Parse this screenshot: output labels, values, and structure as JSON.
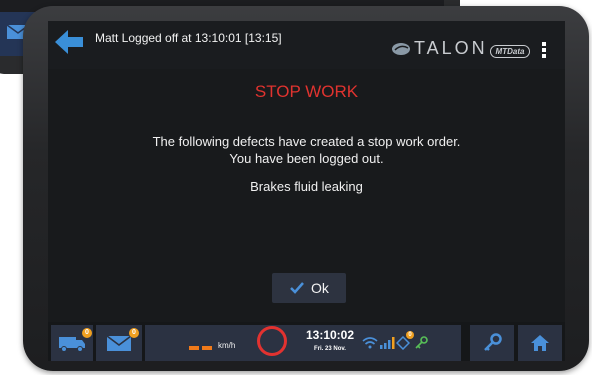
{
  "header": {
    "status_message": "Matt Logged off at 13:10:01 [13:15]",
    "brand": "TALON",
    "partner_logo": "MTData",
    "back_icon": "arrow-left-icon",
    "menu_icon": "kebab-menu-icon"
  },
  "dialog": {
    "title": "STOP WORK",
    "message_line1": "The following defects have created a stop work order.",
    "message_line2": "You have been logged out.",
    "defect": "Brakes fluid leaking",
    "ok_label": "Ok"
  },
  "bottom_bar": {
    "truck_badge": "0",
    "mail_badge": "0",
    "speed_unit": "km/h",
    "time": "13:10:02",
    "date": "Fri. 23 Nov.",
    "indicator_badge": "0"
  },
  "colors": {
    "title_red": "#e0332f",
    "accent_blue": "#4a90d9",
    "badge_orange": "#f0a020",
    "speed_orange": "#f07a1a",
    "key_green": "#58c058"
  }
}
